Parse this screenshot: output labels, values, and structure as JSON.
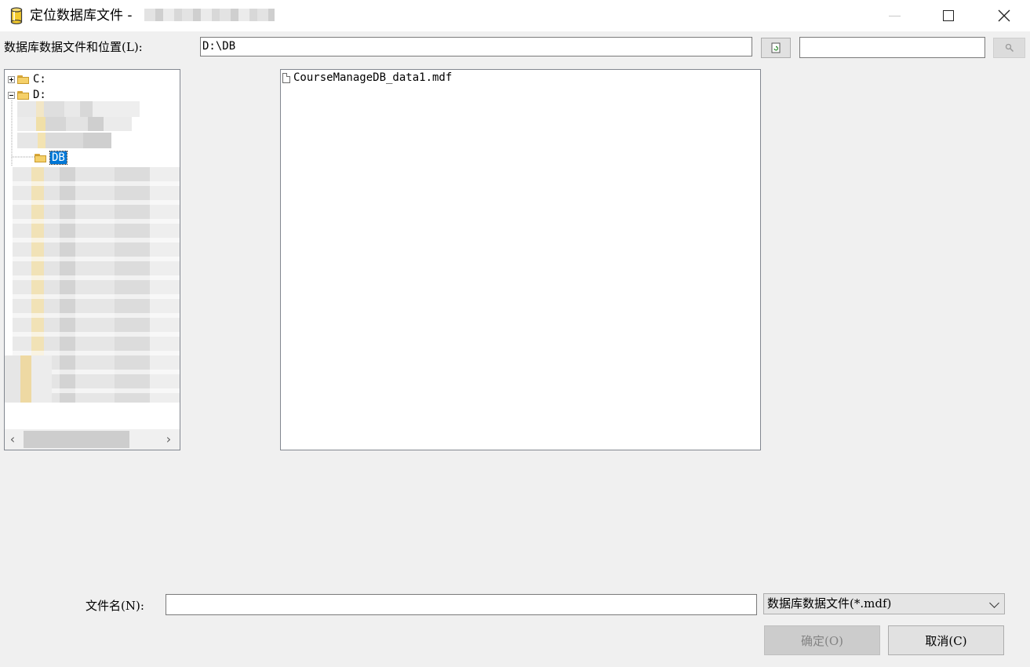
{
  "window": {
    "title": "定位数据库文件 -",
    "controls": {
      "minimize_icon": "minimize-icon",
      "maximize_icon": "maximize-icon",
      "close_icon": "close-icon"
    }
  },
  "location": {
    "label": "数据库数据文件和位置(L):",
    "path": "D:\\DB",
    "refresh_icon": "refresh-icon",
    "search_value": "",
    "search_icon": "search-icon"
  },
  "tree": {
    "nodes": [
      {
        "label": "C:",
        "expanded": false
      },
      {
        "label": "D:",
        "expanded": true
      },
      {
        "label": "DB",
        "selected": true
      }
    ],
    "scroll_left_icon": "chevron-left-icon",
    "scroll_right_icon": "chevron-right-icon"
  },
  "files": {
    "items": [
      {
        "name": "CourseManageDB_data1.mdf",
        "icon": "file-icon"
      }
    ]
  },
  "footer": {
    "filename_label": "文件名(N):",
    "filename_value": "",
    "filetype_selected": "数据库数据文件(*.mdf)",
    "ok_label": "确定(O)",
    "cancel_label": "取消(C)"
  },
  "colors": {
    "selection": "#0078d7",
    "window_bg": "#f0f0f0",
    "disabled_text": "#838383"
  }
}
